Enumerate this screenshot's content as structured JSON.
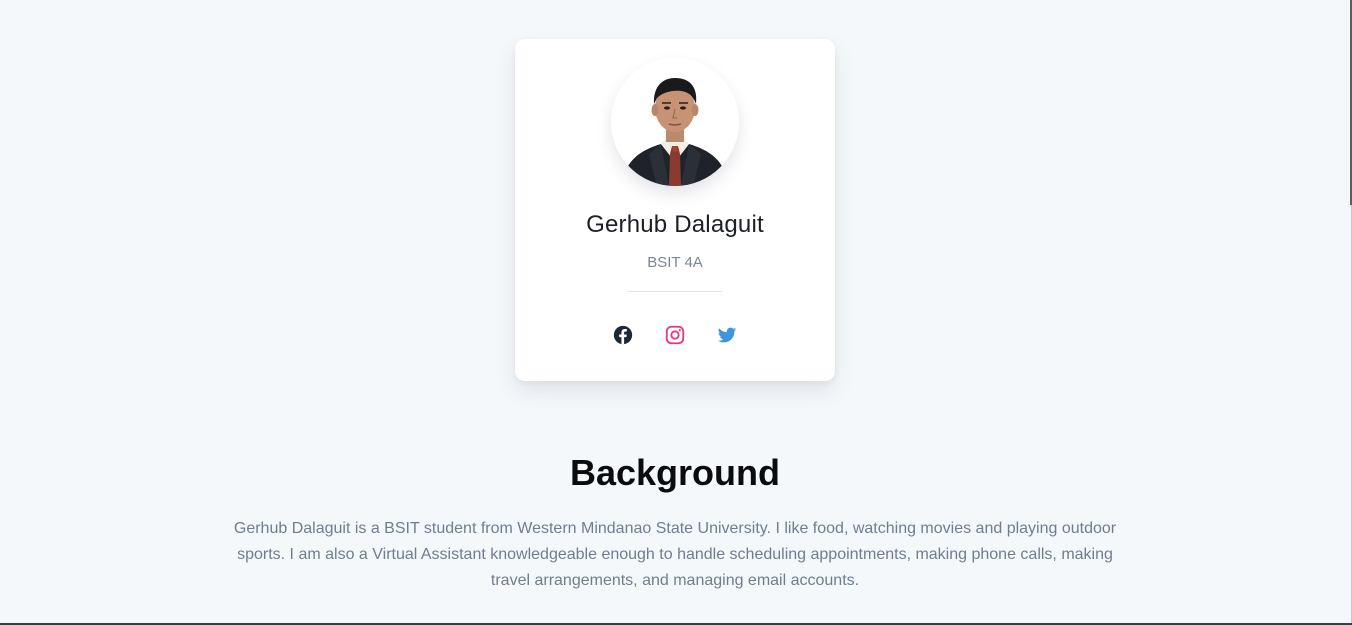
{
  "profile": {
    "name": "Gerhub Dalaguit",
    "subtitle": "BSIT 4A",
    "avatar_alt": "profile photo"
  },
  "socials": [
    {
      "name": "facebook",
      "icon": "facebook-icon",
      "color": "#1c2738"
    },
    {
      "name": "instagram",
      "icon": "instagram-icon",
      "color": "#e13a82"
    },
    {
      "name": "twitter",
      "icon": "twitter-icon",
      "color": "#3e95df"
    }
  ],
  "background": {
    "heading": "Background",
    "text": "Gerhub Dalaguit is a BSIT student from Western Mindanao State University. I like food, watching movies and playing outdoor sports. I am also a Virtual Assistant knowledgeable enough to handle scheduling appointments, making phone calls, making travel arrangements, and managing email accounts."
  },
  "colors": {
    "page_bg": "#f5f8fb",
    "card_bg": "#ffffff",
    "name": "#1c1f26",
    "muted": "#7a8596"
  }
}
